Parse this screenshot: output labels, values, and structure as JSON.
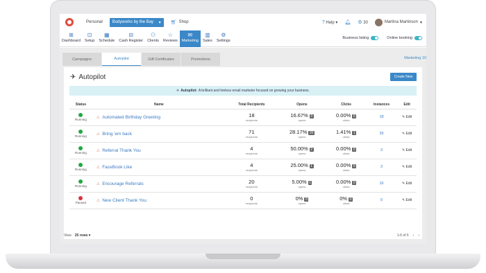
{
  "topbar": {
    "personal": "Personal",
    "business": "Bodyworks by the Bay",
    "shop": "Shop",
    "help": "Help",
    "notif_count": "30",
    "user": "Martina Martinson"
  },
  "nav": [
    {
      "icon": "dashboard-icon",
      "glyph": "⊞",
      "label": "Dashboard"
    },
    {
      "icon": "setup-icon",
      "glyph": "⊡",
      "label": "Setup"
    },
    {
      "icon": "schedule-icon",
      "glyph": "▦",
      "label": "Schedule"
    },
    {
      "icon": "cash-register-icon",
      "glyph": "⊟",
      "label": "Cash Register"
    },
    {
      "icon": "clients-icon",
      "glyph": "⚇",
      "label": "Clients"
    },
    {
      "icon": "reviews-icon",
      "glyph": "☆",
      "label": "Reviews"
    },
    {
      "icon": "marketing-icon",
      "glyph": "✉",
      "label": "Marketing",
      "active": true
    },
    {
      "icon": "sales-icon",
      "glyph": "▥",
      "label": "Sales"
    },
    {
      "icon": "settings-icon",
      "glyph": "⚙",
      "label": "Settings"
    }
  ],
  "toggles": {
    "business_listing": "Business listing",
    "online_booking": "Online booking"
  },
  "tabs": [
    "Campaigns",
    "Autopilot",
    "Gift Certificates",
    "Promotions"
  ],
  "marketing_link": "Marketing 10",
  "page": {
    "title": "Autopilot",
    "new_button": "Create New"
  },
  "banner": {
    "bold": "Autopilot:",
    "text": "A brilliant and tireless email marketer focused on growing your business."
  },
  "columns": [
    "Status",
    "Name",
    "Total Recipients",
    "Opens",
    "Clicks",
    "Instances",
    "Edit"
  ],
  "rows": [
    {
      "status": "Running",
      "color": "#22a745",
      "name": "Automated Birthday Greeting",
      "recipients": "18",
      "opens": "16.67%",
      "opens_n": "3",
      "clicks": "0.00%",
      "clicks_n": "0",
      "instances": "18"
    },
    {
      "status": "Running",
      "color": "#22a745",
      "name": "Bring 'em back",
      "recipients": "71",
      "opens": "28.17%",
      "opens_n": "20",
      "clicks": "1.41%",
      "clicks_n": "1",
      "instances": "35"
    },
    {
      "status": "Running",
      "color": "#22a745",
      "name": "Referral Thank You",
      "recipients": "4",
      "opens": "50.00%",
      "opens_n": "2",
      "clicks": "0.00%",
      "clicks_n": "0",
      "instances": "3"
    },
    {
      "status": "Running",
      "color": "#22a745",
      "name": "FaceBook Like",
      "recipients": "4",
      "opens": "25.00%",
      "opens_n": "1",
      "clicks": "0.00%",
      "clicks_n": "0",
      "instances": "3"
    },
    {
      "status": "Running",
      "color": "#22a745",
      "name": "Encourage Referrals",
      "recipients": "20",
      "opens": "5.00%",
      "opens_n": "1",
      "clicks": "0.00%",
      "clicks_n": "0",
      "instances": "16"
    },
    {
      "status": "Paused",
      "color": "#d9333f",
      "name": "New Client Thank You",
      "recipients": "0",
      "opens": "0%",
      "opens_n": "0",
      "clicks": "0%",
      "clicks_n": "0",
      "instances": "0"
    }
  ],
  "labels": {
    "recipients": "recipients",
    "opens": "opens",
    "clicks": "clicks",
    "edit": "Edit"
  },
  "footer": {
    "view": "View",
    "rows": "25 rows",
    "range": "1-6 of 6"
  }
}
